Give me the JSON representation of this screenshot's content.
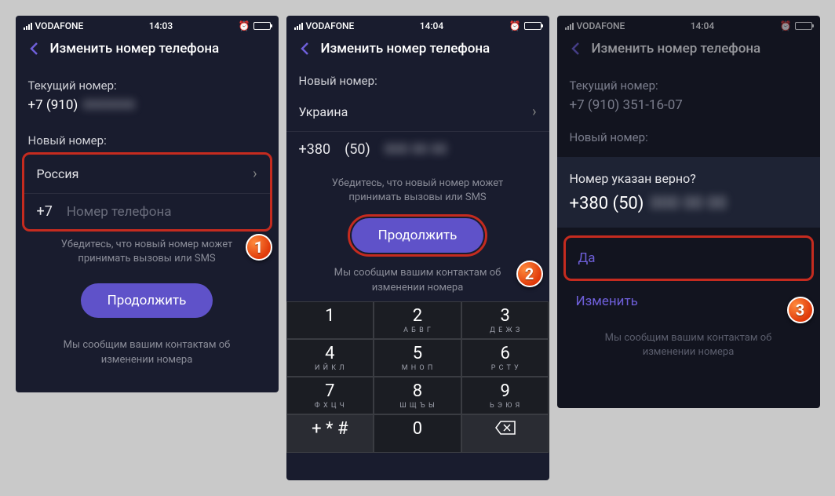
{
  "status": {
    "carrier": "VODAFONE",
    "time1": "14:03",
    "time2": "14:04"
  },
  "header": {
    "title": "Изменить номер телефона"
  },
  "labels": {
    "current": "Текущий номер:",
    "new": "Новый номер:",
    "country1": "Россия",
    "country2": "Украина",
    "prefix1": "+7",
    "prefix2": "+380",
    "area2": "(50)",
    "placeholder": "Номер телефона",
    "hint1": "Убедитесь, что новый номер может принимать вызовы или SMS",
    "continue": "Продолжить",
    "footer": "Мы сообщим вашим контактам об изменении номера",
    "current_display": "+7 (910)",
    "current_display_full": "+7 (910) 351-16-07"
  },
  "confirm": {
    "question": "Номер указан верно?",
    "number": "+380 (50)",
    "yes": "Да",
    "edit": "Изменить"
  },
  "keypad": [
    {
      "d": "1",
      "s": ""
    },
    {
      "d": "2",
      "s": "А Б В Г"
    },
    {
      "d": "3",
      "s": "Д Е Ж З"
    },
    {
      "d": "4",
      "s": "И Й К Л"
    },
    {
      "d": "5",
      "s": "М Н О П"
    },
    {
      "d": "6",
      "s": "Р С Т У"
    },
    {
      "d": "7",
      "s": "Ф Х Ц Ч"
    },
    {
      "d": "8",
      "s": "Ш Щ Ъ Ы"
    },
    {
      "d": "9",
      "s": "Ь Э Ю Я"
    },
    {
      "d": "+ * #",
      "s": "",
      "alt": true
    },
    {
      "d": "0",
      "s": ""
    },
    {
      "del": true,
      "alt": true
    }
  ],
  "badges": {
    "b1": "1",
    "b2": "2",
    "b3": "3"
  }
}
